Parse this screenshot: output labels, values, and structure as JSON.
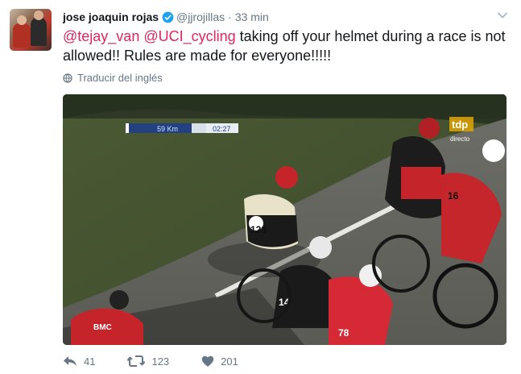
{
  "tweet": {
    "author_name": "jose joaquin rojas",
    "author_handle": "@jjrojillas",
    "separator": "·",
    "timestamp": "33 min",
    "mention1": "@tejay_van",
    "mention2": "@UCI_cycling",
    "body_line1_rest": " taking off your helmet during a race is not",
    "body_line2": "allowed!! Rules are made for everyone!!!!!",
    "translate_label": "Traducir del inglés"
  },
  "video_overlay": {
    "distance": "59 Km",
    "clock": "02:27",
    "broadcaster": "tdp",
    "live_label": "directo",
    "bib_a": "123",
    "bib_b": "16",
    "bib_c": "14",
    "bib_d": "78",
    "jersey_brand": "BMC"
  },
  "actions": {
    "reply_count": "41",
    "retweet_count": "123",
    "like_count": "201"
  },
  "colors": {
    "mention": "#e0245e",
    "verified": "#1da1f2",
    "meta_gray": "#657786"
  },
  "icons": [
    "verified-icon",
    "caret-down-icon",
    "globe-icon",
    "reply-icon",
    "retweet-icon",
    "heart-icon"
  ]
}
